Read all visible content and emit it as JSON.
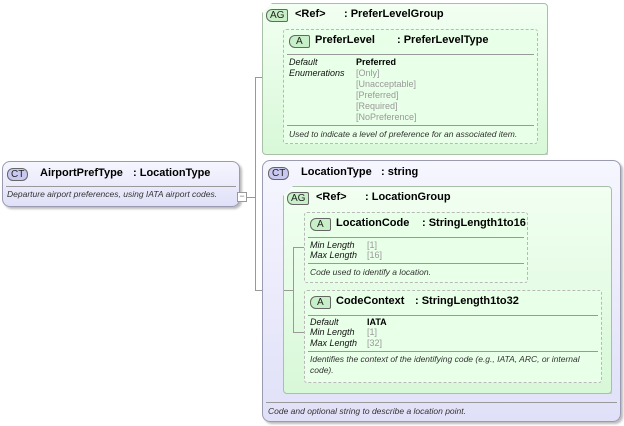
{
  "root": {
    "badge": "CT",
    "name": "AirportPrefType",
    "type": ": LocationType",
    "description": "Departure airport preferences, using IATA airport codes.",
    "collapse": "−"
  },
  "prefer_group": {
    "badge": "AG",
    "ref": "<Ref>",
    "type": ": PreferLevelGroup",
    "attr": {
      "badge": "A",
      "name": "PreferLevel",
      "type": ": PreferLevelType",
      "default_label": "Default",
      "default_value": "Preferred",
      "enum_label": "Enumerations",
      "enums": [
        "[Only]",
        "[Unacceptable]",
        "[Preferred]",
        "[Required]",
        "[NoPreference]"
      ],
      "description": "Used to indicate a level of preference for an associated item."
    }
  },
  "location_type": {
    "badge": "CT",
    "name": "LocationType",
    "type": ": string",
    "description": "Code and optional string to describe a location point.",
    "group": {
      "badge": "AG",
      "ref": "<Ref>",
      "type": ": LocationGroup",
      "code": {
        "badge": "A",
        "name": "LocationCode",
        "type": ": StringLength1to16",
        "min_label": "Min Length",
        "min": "[1]",
        "max_label": "Max Length",
        "max": "[16]",
        "description": "Code used to identify a location."
      },
      "context": {
        "badge": "A",
        "name": "CodeContext",
        "type": ": StringLength1to32",
        "default_label": "Default",
        "default_value": "IATA",
        "min_label": "Min Length",
        "min": "[1]",
        "max_label": "Max Length",
        "max": "[32]",
        "description": "Identifies the context of the identifying code (e.g., IATA, ARC, or internal code)."
      }
    }
  }
}
